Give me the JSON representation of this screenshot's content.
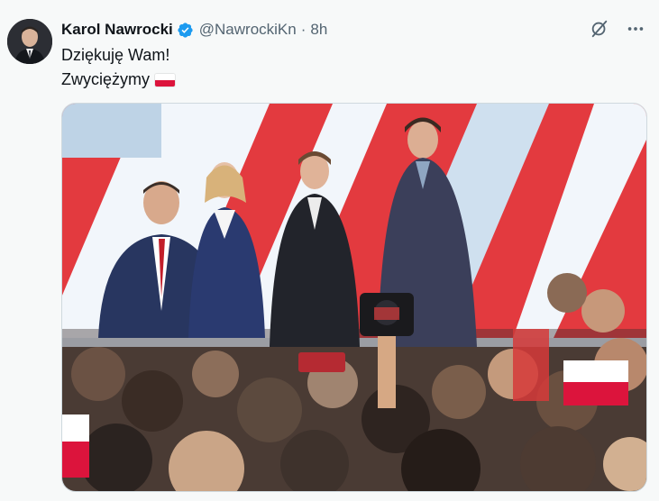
{
  "tweet": {
    "author_name": "Karol Nawrocki",
    "handle": "@NawrockiKn",
    "separator": "·",
    "time": "8h",
    "verified": true,
    "text_lines": [
      "Dziękuję Wam!",
      "Zwyciężymy"
    ],
    "flag_emoji": "polish-flag-icon"
  },
  "colors": {
    "verified_blue": "#1d9bf0",
    "secondary_text": "#536471",
    "stage_red": "#e0303a",
    "background": "#f7f9f9"
  }
}
